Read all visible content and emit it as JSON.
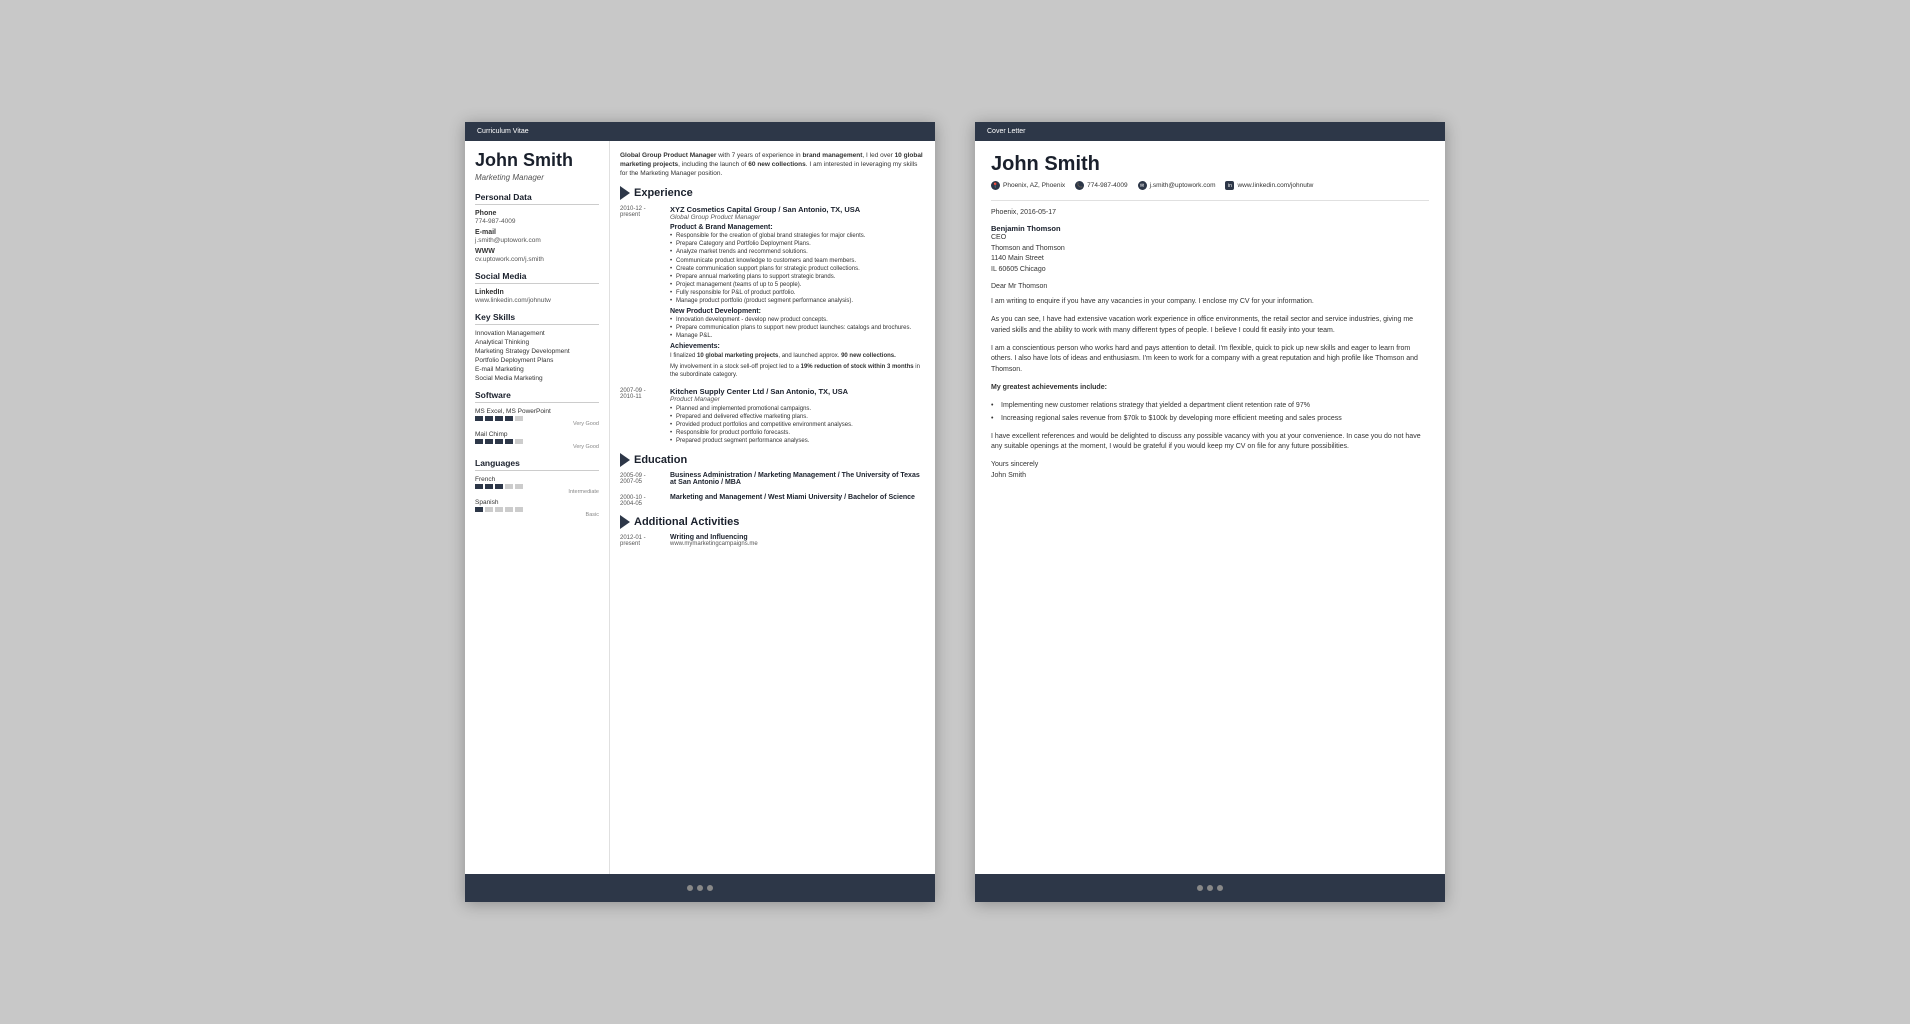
{
  "cv": {
    "header": "Curriculum Vitae",
    "name": "John Smith",
    "title": "Marketing Manager",
    "personal": {
      "section_title": "Personal Data",
      "phone_label": "Phone",
      "phone": "774-987-4009",
      "email_label": "E-mail",
      "email": "j.smith@uptowork.com",
      "www_label": "WWW",
      "www": "cv.uptowork.com/j.smith"
    },
    "social": {
      "section_title": "Social Media",
      "linkedin_label": "LinkedIn",
      "linkedin": "www.linkedin.com/johnutw"
    },
    "skills": {
      "section_title": "Key Skills",
      "items": [
        "Innovation Management",
        "Analytical Thinking",
        "Marketing Strategy Development",
        "Portfolio Deployment Plans",
        "E-mail Marketing",
        "Social Media Marketing"
      ]
    },
    "software": {
      "section_title": "Software",
      "items": [
        {
          "name": "MS Excel, MS PowerPoint",
          "rating": 4,
          "max": 5,
          "label": "Very Good"
        },
        {
          "name": "Mail Chimp",
          "rating": 4,
          "max": 5,
          "label": "Very Good"
        }
      ]
    },
    "languages": {
      "section_title": "Languages",
      "items": [
        {
          "name": "French",
          "rating": 3,
          "max": 5,
          "label": "Intermediate"
        },
        {
          "name": "Spanish",
          "rating": 1,
          "max": 5,
          "label": "Basic"
        }
      ]
    },
    "summary": "Global Group Product Manager with 7 years of experience in brand management, I led over 10 global marketing projects, including the launch of 60 new collections. I am interested in leveraging my skills for the Marketing Manager position.",
    "experience": {
      "section_title": "Experience",
      "entries": [
        {
          "date": "2010-12 - present",
          "company": "XYZ Cosmetics Capital Group / San Antonio, TX, USA",
          "job_title": "Global Group Product Manager",
          "sections": [
            {
              "title": "Product & Brand Management:",
              "bullets": [
                "Responsible for the creation of global brand strategies for major clients.",
                "Prepare Category and Portfolio Deployment Plans.",
                "Analyze market trends and recommend solutions.",
                "Communicate product knowledge to customers and team members.",
                "Create communication support plans for strategic product collections.",
                "Prepare annual marketing plans to support strategic brands.",
                "Project management (teams of up to 5 people).",
                "Fully responsible for P&L of product portfolio.",
                "Manage product portfolio (product segment performance analysis)."
              ]
            },
            {
              "title": "New Product Development:",
              "bullets": [
                "Innovation development - develop new product concepts.",
                "Prepare communication plans to support new product launches: catalogs and brochures.",
                "Manage P&L."
              ]
            }
          ],
          "achievements_title": "Achievements:",
          "achievements": [
            "I finalized 10 global marketing projects, and launched approx. 90 new collections.",
            "My involvement in a stock sell-off project led to a 19% reduction of stock within 3 months in the subordinate category."
          ]
        },
        {
          "date": "2007-09 - 2010-11",
          "company": "Kitchen Supply Center Ltd / San Antonio, TX, USA",
          "job_title": "Product Manager",
          "bullets": [
            "Planned and implemented promotional campaigns.",
            "Prepared and delivered effective marketing plans.",
            "Provided product portfolios and competitive environment analyses.",
            "Responsible for product portfolio forecasts.",
            "Prepared product segment performance analyses."
          ]
        }
      ]
    },
    "education": {
      "section_title": "Education",
      "entries": [
        {
          "date": "2005-09 - 2007-05",
          "degree": "Business Administration / Marketing Management / The University of Texas at San Antonio / MBA"
        },
        {
          "date": "2000-10 - 2004-05",
          "degree": "Marketing and Management / West Miami University / Bachelor of Science"
        }
      ]
    },
    "activities": {
      "section_title": "Additional Activities",
      "entries": [
        {
          "date": "2012-01 - present",
          "title": "Writing and Influencing",
          "url": "www.mymarketingcampaigns.me"
        }
      ]
    }
  },
  "cover": {
    "header": "Cover Letter",
    "name": "John Smith",
    "contact": {
      "location": "Phoenix, AZ, Phoenix",
      "phone": "774-987-4009",
      "email": "j.smith@uptowork.com",
      "linkedin": "www.linkedin.com/johnutw"
    },
    "date": "Phoenix, 2016-05-17",
    "recipient": {
      "name": "Benjamin Thomson",
      "title": "CEO",
      "company": "Thomson and Thomson",
      "address": "1140 Main Street",
      "city": "IL 60605 Chicago"
    },
    "salutation": "Dear Mr Thomson",
    "paragraphs": [
      "I am writing to enquire if you have any vacancies in your company. I enclose my CV for your information.",
      "As you can see, I have had extensive vacation work experience in office environments, the retail sector and service industries, giving me varied skills and the ability to work with many different types of people. I believe I could fit easily into your team.",
      "I am a conscientious person who works hard and pays attention to detail. I'm flexible, quick to pick up new skills and eager to learn from others. I also have lots of ideas and enthusiasm. I'm keen to work for a company with a great reputation and high profile like Thomson and Thomson."
    ],
    "achievements_title": "My greatest achievements include:",
    "achievements": [
      "Implementing new customer relations strategy that yielded a department client retention rate of 97%",
      "Increasing regional sales revenue from $70k to $100k by developing more efficient meeting and sales process"
    ],
    "closing_paragraph": "I have excellent references and would be delighted to discuss any possible vacancy with you at your convenience. In case you do not have any suitable openings at the moment, I would be grateful if you would keep my CV on file for any future possibilities.",
    "closing": "Yours sincerely",
    "signature": "John Smith"
  }
}
